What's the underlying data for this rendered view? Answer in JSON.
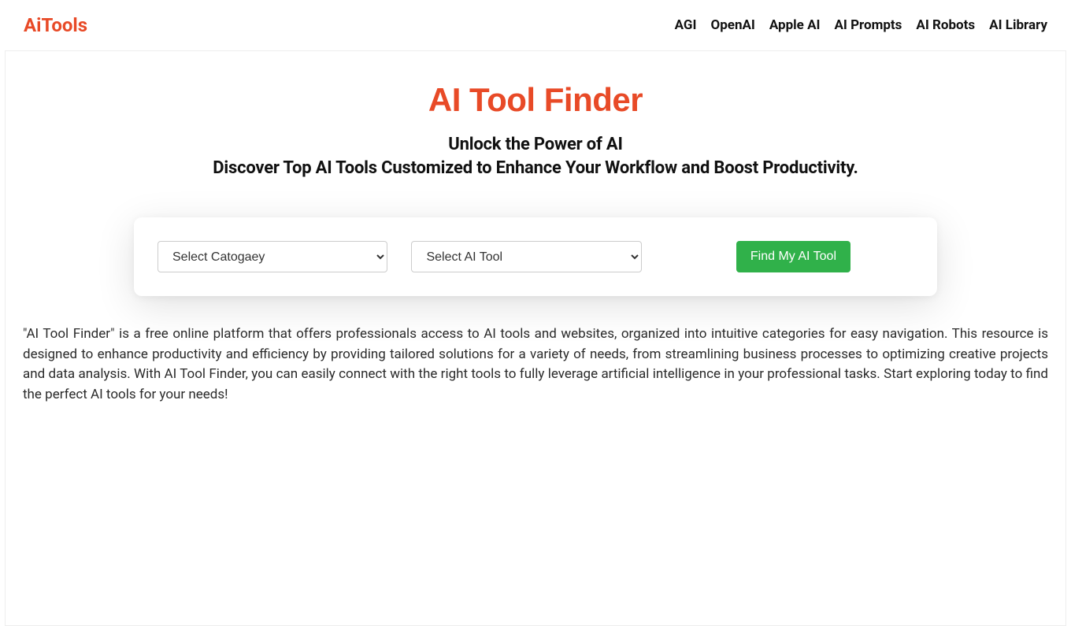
{
  "header": {
    "logo": "AiTools",
    "nav": [
      "AGI",
      "OpenAI",
      "Apple AI",
      "AI Prompts",
      "AI Robots",
      "AI Library"
    ]
  },
  "main": {
    "title": "AI Tool Finder",
    "subtitle_line1": "Unlock the Power of AI",
    "subtitle_line2": "Discover Top AI Tools Customized to Enhance Your Workflow and Boost Productivity.",
    "select_category_placeholder": "Select Catogaey",
    "select_tool_placeholder": "Select AI Tool",
    "find_button": "Find My AI Tool",
    "description": "\"AI Tool Finder\" is a free online platform that offers professionals access to AI tools and websites, organized into intuitive categories for easy navigation. This resource is designed to enhance productivity and efficiency by providing tailored solutions for a variety of needs, from streamlining business processes to optimizing creative projects and data analysis. With AI Tool Finder, you can easily connect with the right tools to fully leverage artificial intelligence in your professional tasks. Start exploring today to find the perfect AI tools for your needs!"
  }
}
